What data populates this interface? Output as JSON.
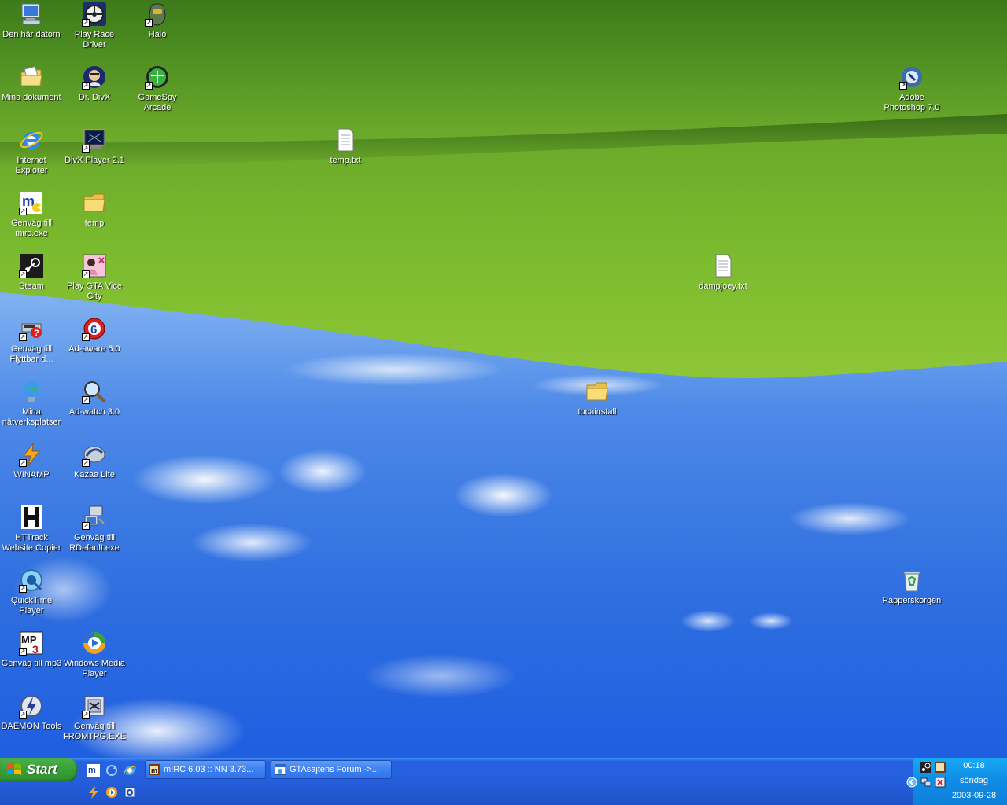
{
  "desktop": {
    "icons": [
      {
        "label": "Den här datorn",
        "icon": "my-computer-icon"
      },
      {
        "label": "Play Race Driver",
        "icon": "race-driver-icon"
      },
      {
        "label": "Halo",
        "icon": "halo-icon"
      },
      {
        "label": "Mina dokument",
        "icon": "my-documents-icon"
      },
      {
        "label": "Dr. DivX",
        "icon": "dr-divx-icon"
      },
      {
        "label": "GameSpy Arcade",
        "icon": "gamespy-icon"
      },
      {
        "label": "Adobe Photoshop 7.0",
        "icon": "photoshop-icon"
      },
      {
        "label": "Internet Explorer",
        "icon": "internet-explorer-icon"
      },
      {
        "label": "DivX Player 2.1",
        "icon": "divx-player-icon"
      },
      {
        "label": "temp.txt",
        "icon": "text-file-icon"
      },
      {
        "label": "Genväg till mirc.exe",
        "icon": "mirc-icon"
      },
      {
        "label": "temp",
        "icon": "folder-icon"
      },
      {
        "label": "Steam",
        "icon": "steam-icon"
      },
      {
        "label": "Play GTA Vice City",
        "icon": "gta-vice-city-icon"
      },
      {
        "label": "dampjoey.txt",
        "icon": "text-file-icon"
      },
      {
        "label": "Genväg till Flyttbar d...",
        "icon": "removable-drive-icon"
      },
      {
        "label": "Ad-aware 6.0",
        "icon": "ad-aware-icon"
      },
      {
        "label": "Mina nätverksplatser",
        "icon": "network-places-icon"
      },
      {
        "label": "Ad-watch 3.0",
        "icon": "ad-watch-icon"
      },
      {
        "label": "tocainstall",
        "icon": "folder-icon"
      },
      {
        "label": "WINAMP",
        "icon": "winamp-icon"
      },
      {
        "label": "Kazaa Lite",
        "icon": "kazaa-icon"
      },
      {
        "label": "HTTrack Website Copier",
        "icon": "httrack-icon"
      },
      {
        "label": "Genväg till RDefault.exe",
        "icon": "rdefault-icon"
      },
      {
        "label": "QuickTime Player",
        "icon": "quicktime-icon"
      },
      {
        "label": "Papperskorgen",
        "icon": "recycle-bin-icon"
      },
      {
        "label": "Genväg till mp3",
        "icon": "mp3-icon"
      },
      {
        "label": "Windows Media Player",
        "icon": "media-player-icon"
      },
      {
        "label": "DAEMON Tools",
        "icon": "daemon-tools-icon"
      },
      {
        "label": "Genväg till FROMTPG.EXE",
        "icon": "fromtpg-icon"
      }
    ]
  },
  "taskbar": {
    "start_label": "Start",
    "tasks": [
      {
        "label": "mIRC 6.03 :: NN 3.73...",
        "icon": "mirc-icon"
      },
      {
        "label": "GTAsajtens Forum ->...",
        "icon": "browser-window-icon"
      }
    ],
    "clock": {
      "time": "00:18",
      "day": "söndag",
      "date": "2003-09-28"
    }
  },
  "colors": {
    "taskbar_blue": "#245edb",
    "start_green": "#39a239",
    "tray_blue": "#0f8be6"
  }
}
